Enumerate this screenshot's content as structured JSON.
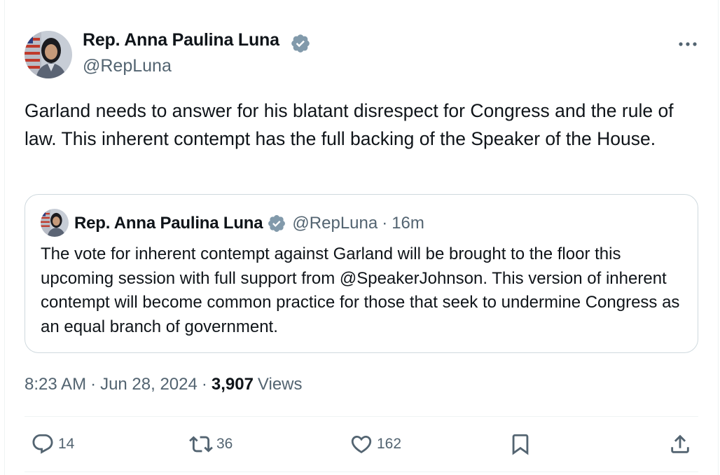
{
  "tweet": {
    "author": {
      "name": "Rep. Anna Paulina Luna",
      "handle": "@RepLuna",
      "verified": true
    },
    "text": "Garland needs to answer for his blatant disrespect for Congress and the rule of law. This inherent contempt has the full backing of the Speaker of the House.",
    "time": "8:23 AM",
    "date": "Jun 28, 2024",
    "views_count": "3,907",
    "views_label": "Views",
    "separator": "·"
  },
  "quote": {
    "author": {
      "name": "Rep. Anna Paulina Luna",
      "handle": "@RepLuna",
      "verified": true
    },
    "age": "16m",
    "separator": "·",
    "text": "The vote for inherent contempt against Garland will be brought to the floor this upcoming session with full support from @SpeakerJohnson. This version of inherent contempt will become common practice for those that seek to undermine Congress as an equal branch of government."
  },
  "actions": {
    "replies": "14",
    "retweets": "36",
    "likes": "162"
  },
  "icons": {
    "verified": "verified-badge-icon",
    "more": "more-horizontal-icon",
    "reply": "reply-icon",
    "retweet": "retweet-icon",
    "like": "heart-icon",
    "bookmark": "bookmark-icon",
    "share": "share-icon"
  },
  "colors": {
    "verified_badge": "#829aab",
    "text_primary": "#0f1419",
    "text_secondary": "#536471",
    "border": "#cfd9de"
  }
}
